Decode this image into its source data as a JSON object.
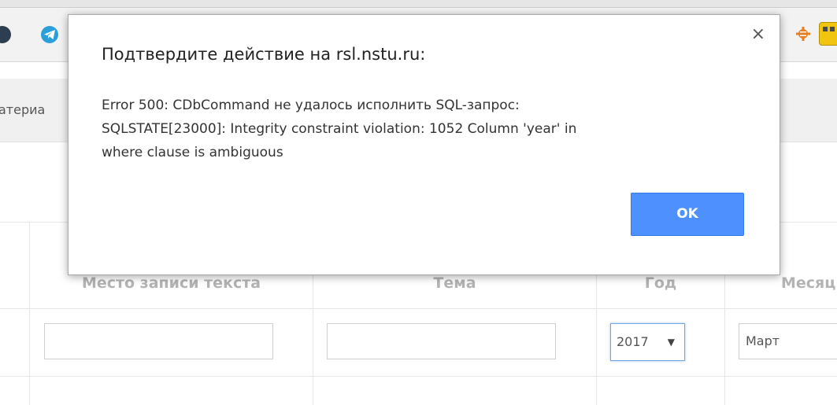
{
  "browser": {
    "extensions": [
      "dark-circle-icon",
      "telegram-icon",
      "settings-gear-icon",
      "bus-icon"
    ]
  },
  "navbar": {
    "partial_text": "атериа"
  },
  "table": {
    "headers": [
      "Место записи текста",
      "Тема",
      "Год",
      "Месяц"
    ],
    "row": {
      "place_value": "",
      "topic_value": "",
      "year_value": "2017",
      "month_value": "Март"
    }
  },
  "dialog": {
    "title": "Подтвердите действие на rsl.nstu.ru:",
    "message_lines": [
      "Error 500: CDbCommand не удалось исполнить SQL-запрос:",
      "SQLSTATE[23000]: Integrity constraint violation: 1052 Column 'year' in",
      "where clause is ambiguous"
    ],
    "close_label": "×",
    "ok_label": "OK"
  },
  "colors": {
    "ok_button": "#4d90fe",
    "select_focus_border": "#6fa7e6",
    "header_text": "#b3b3b3"
  }
}
